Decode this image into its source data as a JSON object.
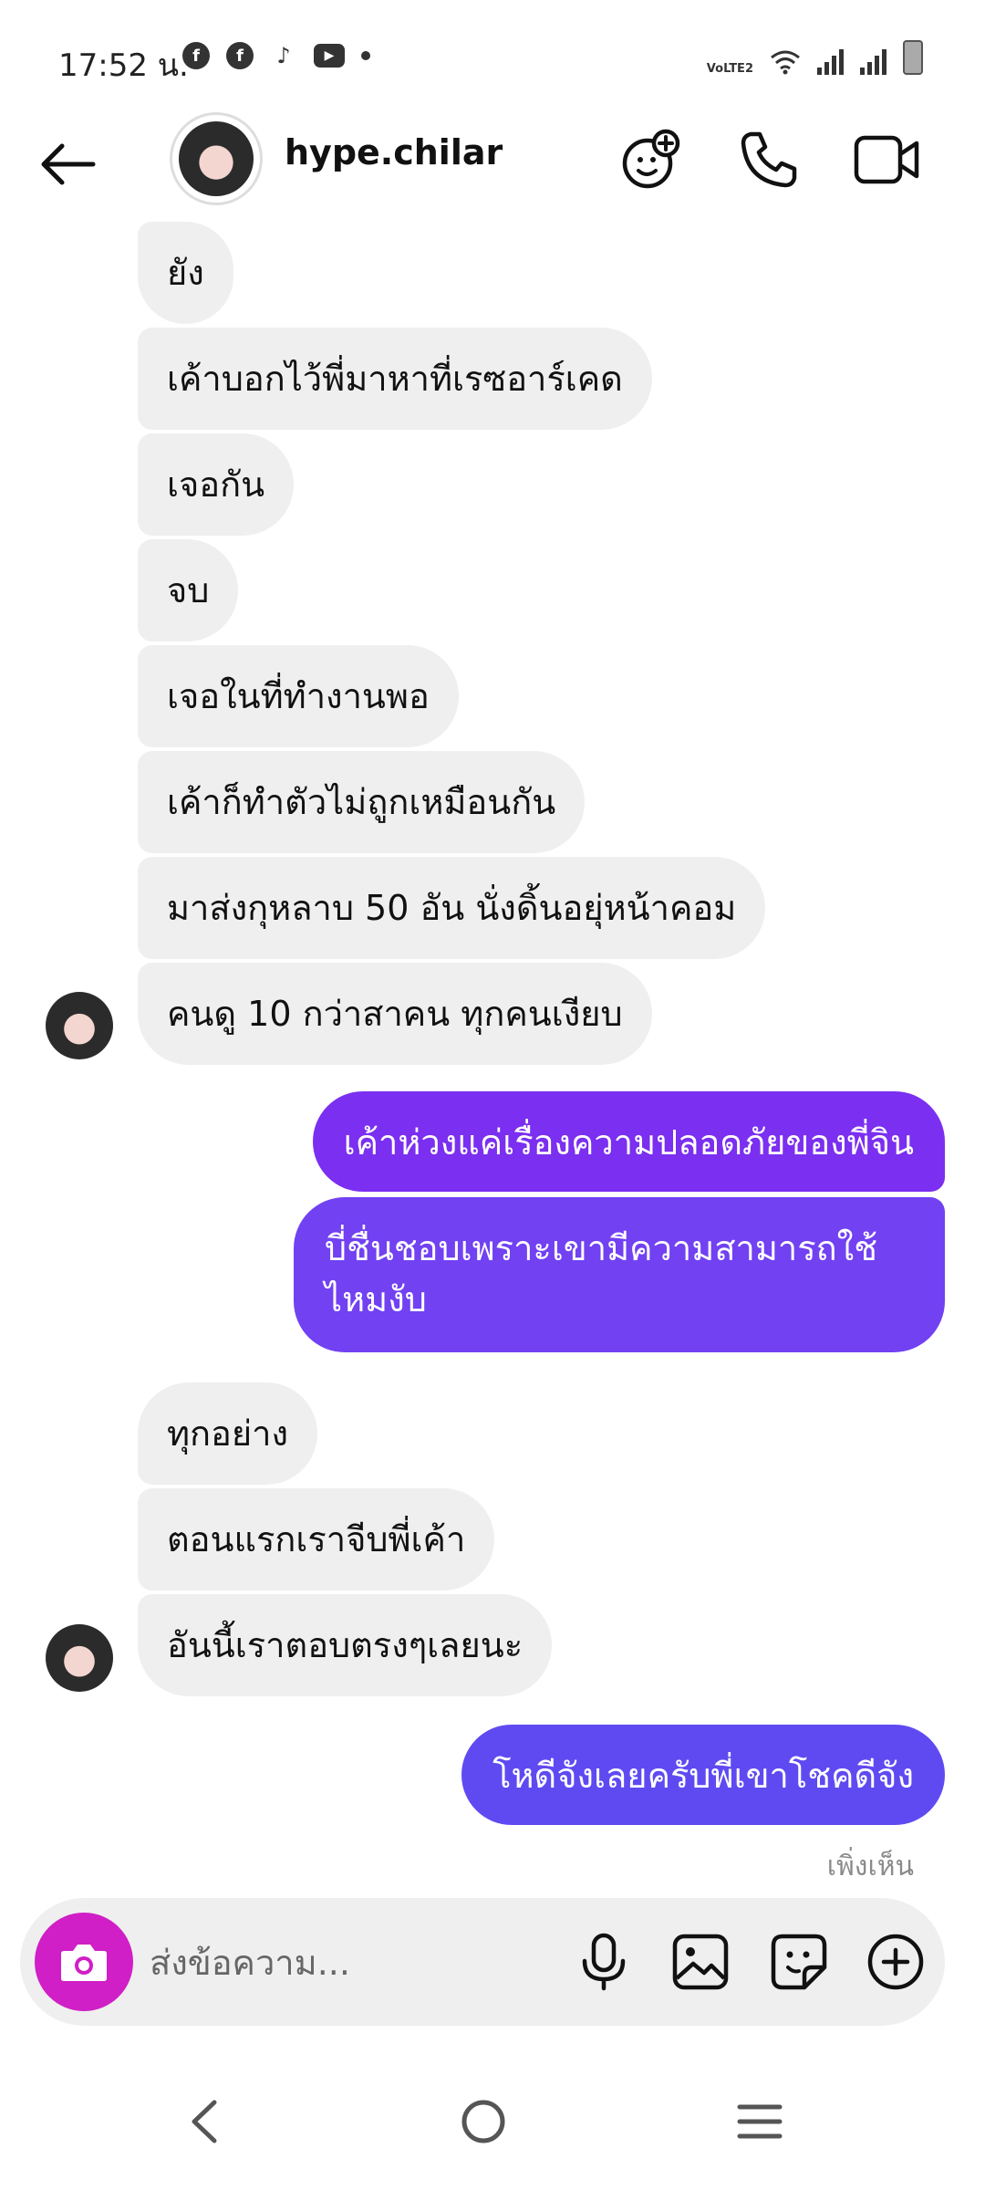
{
  "status_bar": {
    "time": "17:52 น.",
    "notif_icons": [
      "facebook-icon",
      "facebook-icon",
      "tiktok-icon",
      "youtube-icon",
      "dot-icon"
    ],
    "network_label": "VoLTE2"
  },
  "header": {
    "username": "hype.chilar",
    "icons": [
      "back-arrow-icon",
      "add-effect-icon",
      "phone-icon",
      "video-icon"
    ]
  },
  "messages": [
    {
      "from": "them",
      "text": "ยัง"
    },
    {
      "from": "them",
      "text": "เค้าบอกไว้พี่มาหาที่เรซอาร์เคด"
    },
    {
      "from": "them",
      "text": "เจอกัน"
    },
    {
      "from": "them",
      "text": "จบ"
    },
    {
      "from": "them",
      "text": "เจอในที่ทำงานพอ"
    },
    {
      "from": "them",
      "text": "เค้าก็ทำตัวไม่ถูกเหมือนกัน"
    },
    {
      "from": "them",
      "text": "มาส่งกุหลาบ 50 อัน นั่งดิ้นอยุ่หน้าคอม"
    },
    {
      "from": "them",
      "text": "คนดู 10 กว่าสาคน ทุกคนเงียบ"
    },
    {
      "from": "me",
      "text": "เค้าห่วงแค่เรื่องความปลอดภัยของพี่จิน"
    },
    {
      "from": "me",
      "text_line1": "บี่ชื่นชอบเพราะเขามีความสามารถใช้",
      "text_line2": "ไหมงับ"
    },
    {
      "from": "them",
      "text": "ทุกอย่าง"
    },
    {
      "from": "them",
      "text": "ตอนแรกเราจีบพี่เค้า"
    },
    {
      "from": "them",
      "text": "อันนี้เราตอบตรงๆเลยนะ"
    },
    {
      "from": "me",
      "text": "โหดีจังเลยครับพี่เขาโชคดีจัง"
    }
  ],
  "seen_label": "เพิ่งเห็น",
  "composer": {
    "placeholder": "ส่งข้อความ...",
    "icons": [
      "camera-icon",
      "microphone-icon",
      "image-icon",
      "sticker-icon",
      "plus-circle-icon"
    ]
  },
  "colors": {
    "incoming_bubble": "#efefef",
    "outgoing_bubble_1": "#7b2ff0",
    "outgoing_bubble_2": "#7141f2",
    "outgoing_bubble_3": "#5f4af2",
    "camera_button": "#d01fc6"
  },
  "nav_bar": {
    "icons": [
      "nav-back-icon",
      "nav-home-icon",
      "nav-recents-icon"
    ]
  }
}
